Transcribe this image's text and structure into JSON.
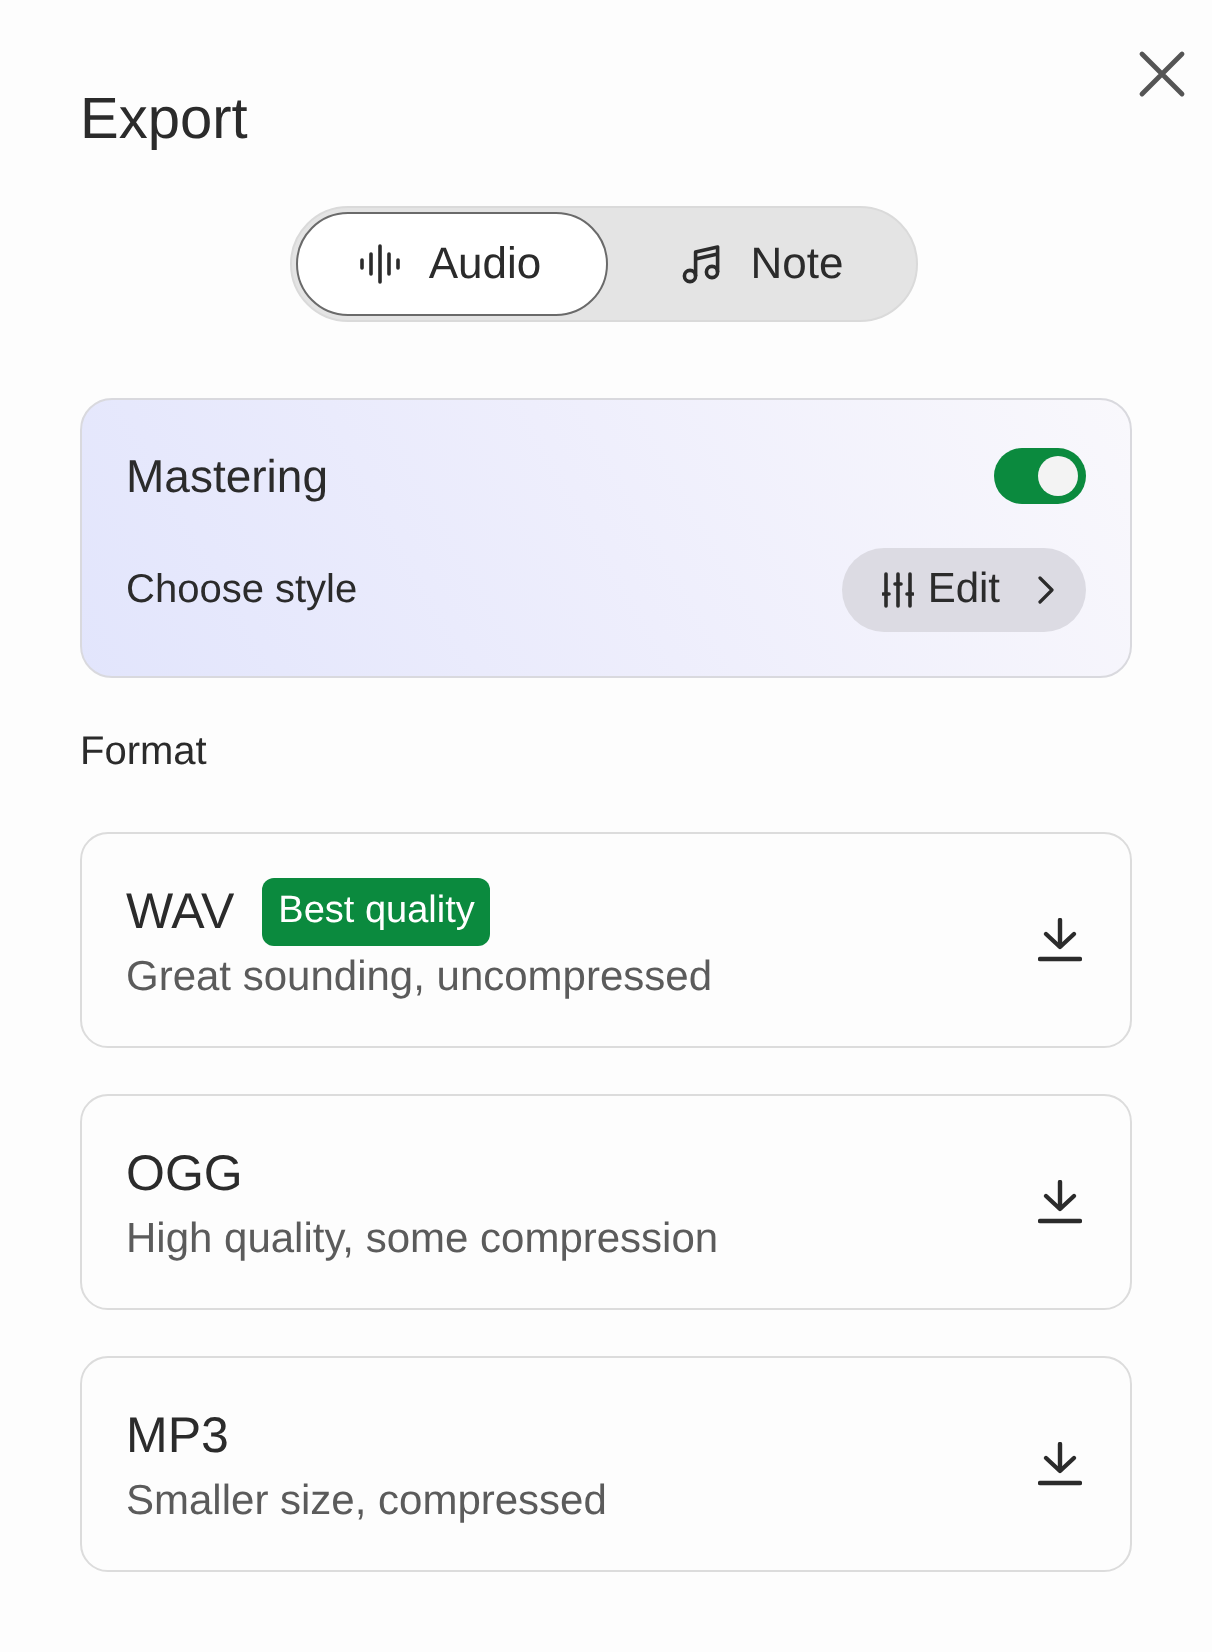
{
  "dialog": {
    "title": "Export"
  },
  "tabs": [
    {
      "label": "Audio",
      "kind": "audio",
      "selected": true
    },
    {
      "label": "Note",
      "kind": "note",
      "selected": false
    }
  ],
  "mastering": {
    "label": "Mastering",
    "on": true,
    "style_label": "Choose style",
    "edit_button": "Edit"
  },
  "format": {
    "heading": "Format",
    "options": [
      {
        "name": "WAV",
        "badge": "Best quality",
        "description": "Great sounding, uncompressed"
      },
      {
        "name": "OGG",
        "description": "High quality, some compression"
      },
      {
        "name": "MP3",
        "description": "Smaller size, compressed"
      }
    ]
  }
}
